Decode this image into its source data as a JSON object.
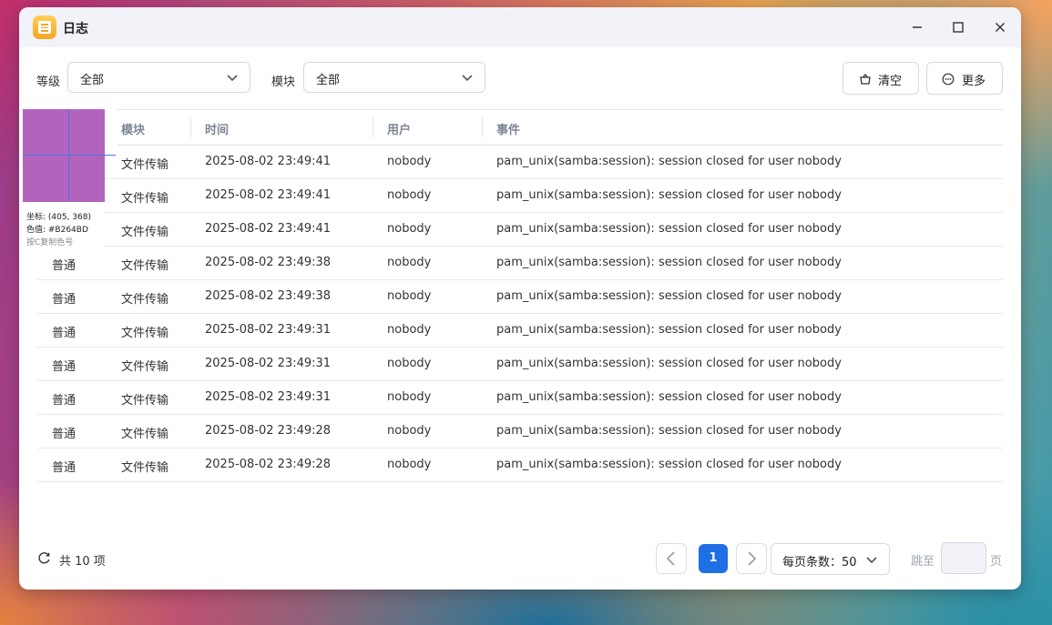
{
  "window": {
    "title": "日志",
    "minimize_icon": "minimize-icon",
    "maximize_icon": "maximize-icon",
    "close_icon": "close-icon"
  },
  "filters": {
    "level_label": "等级",
    "level_value": "全部",
    "module_label": "模块",
    "module_value": "全部"
  },
  "actions": {
    "clear_label": "清空",
    "more_label": "更多"
  },
  "table": {
    "columns": [
      "模块",
      "时间",
      "用户",
      "事件"
    ],
    "rows": [
      {
        "level": "",
        "module": "文件传输",
        "time": "2025-08-02 23:49:41",
        "user": "nobody",
        "event": "pam_unix(samba:session): session closed for user nobody"
      },
      {
        "level": "",
        "module": "文件传输",
        "time": "2025-08-02 23:49:41",
        "user": "nobody",
        "event": "pam_unix(samba:session): session closed for user nobody"
      },
      {
        "level": "",
        "module": "文件传输",
        "time": "2025-08-02 23:49:41",
        "user": "nobody",
        "event": "pam_unix(samba:session): session closed for user nobody"
      },
      {
        "level": "普通",
        "module": "文件传输",
        "time": "2025-08-02 23:49:38",
        "user": "nobody",
        "event": "pam_unix(samba:session): session closed for user nobody"
      },
      {
        "level": "普通",
        "module": "文件传输",
        "time": "2025-08-02 23:49:38",
        "user": "nobody",
        "event": "pam_unix(samba:session): session closed for user nobody"
      },
      {
        "level": "普通",
        "module": "文件传输",
        "time": "2025-08-02 23:49:31",
        "user": "nobody",
        "event": "pam_unix(samba:session): session closed for user nobody"
      },
      {
        "level": "普通",
        "module": "文件传输",
        "time": "2025-08-02 23:49:31",
        "user": "nobody",
        "event": "pam_unix(samba:session): session closed for user nobody"
      },
      {
        "level": "普通",
        "module": "文件传输",
        "time": "2025-08-02 23:49:31",
        "user": "nobody",
        "event": "pam_unix(samba:session): session closed for user nobody"
      },
      {
        "level": "普通",
        "module": "文件传输",
        "time": "2025-08-02 23:49:28",
        "user": "nobody",
        "event": "pam_unix(samba:session): session closed for user nobody"
      },
      {
        "level": "普通",
        "module": "文件传输",
        "time": "2025-08-02 23:49:28",
        "user": "nobody",
        "event": "pam_unix(samba:session): session closed for user nobody"
      }
    ]
  },
  "color_picker": {
    "coords_text": "坐标: (405, 368)",
    "color_text": "色值: #B264BD",
    "hint_text": "按C复制色号",
    "swatch_color": "#B264BD"
  },
  "footer": {
    "total_text": "共 10 项",
    "current_page": "1",
    "page_size_text": "每页条数：50",
    "jump_label": "跳至",
    "page_suffix": "页"
  },
  "colors": {
    "accent": "#1F6FE5",
    "header_text": "#7D8696"
  }
}
